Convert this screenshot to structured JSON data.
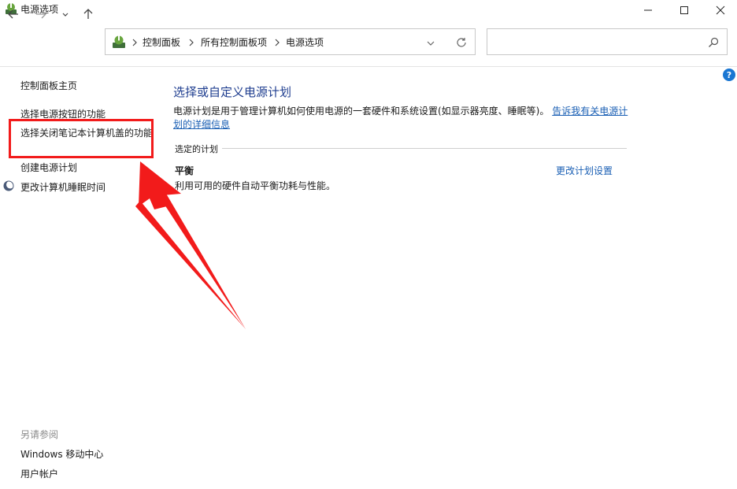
{
  "window": {
    "title": "电源选项",
    "minimize_icon": "minimize-icon",
    "maximize_icon": "maximize-icon",
    "close_icon": "close-icon"
  },
  "nav": {
    "back_icon": "arrow-left-icon",
    "forward_icon": "arrow-right-icon",
    "recent_icon": "chevron-down-icon",
    "up_icon": "arrow-up-icon"
  },
  "address": {
    "icon": "control-panel-icon",
    "crumbs": [
      "控制面板",
      "所有控制面板项",
      "电源选项"
    ]
  },
  "search": {
    "placeholder": "",
    "icon": "search-icon"
  },
  "sidebar": {
    "home": "控制面板主页",
    "items": [
      "选择电源按钮的功能",
      "选择关闭笔记本计算机盖的功能",
      "创建电源计划",
      "更改计算机睡眠时间"
    ],
    "see_also_label": "另请参阅",
    "see_also": [
      "Windows 移动中心",
      "用户帐户"
    ]
  },
  "main": {
    "heading": "选择或自定义电源计划",
    "desc_text": "电源计划是用于管理计算机如何使用电源的一套硬件和系统设置(如显示器亮度、睡眠等)。",
    "desc_link": "告诉我有关电源计划的详细信息",
    "section_label": "选定的计划",
    "plan_name": "平衡",
    "plan_desc": "利用可用的硬件自动平衡功耗与性能。",
    "plan_settings": "更改计划设置",
    "help": "?"
  },
  "annotation": {
    "highlight_color": "#f21b1b"
  },
  "colors": {
    "link": "#1a5fb4",
    "heading": "#1e3d8f",
    "annotation": "#f21b1b"
  }
}
